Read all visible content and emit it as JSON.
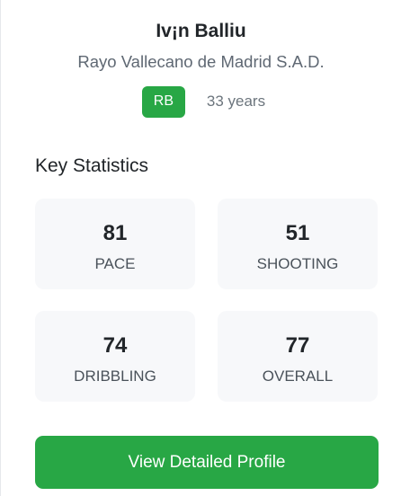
{
  "player": {
    "name": "Iv¡n Balliu",
    "club": "Rayo Vallecano de Madrid S.A.D.",
    "position": "RB",
    "age": "33 years"
  },
  "statistics": {
    "title": "Key Statistics",
    "items": [
      {
        "value": "81",
        "label": "PACE"
      },
      {
        "value": "51",
        "label": "SHOOTING"
      },
      {
        "value": "74",
        "label": "DRIBBLING"
      },
      {
        "value": "77",
        "label": "OVERALL"
      }
    ]
  },
  "actions": {
    "profile_button_label": "View Detailed Profile"
  },
  "colors": {
    "accent": "#28a745",
    "stat_background": "#f7f8fa"
  }
}
